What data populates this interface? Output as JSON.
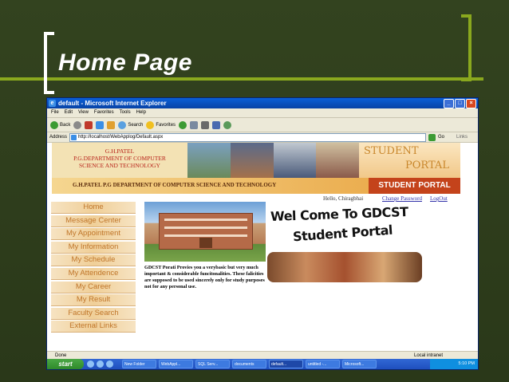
{
  "slide": {
    "title": "Home Page"
  },
  "window": {
    "title": "default - Microsoft Internet Explorer"
  },
  "menu": [
    "File",
    "Edit",
    "View",
    "Favorites",
    "Tools",
    "Help"
  ],
  "toolbar": {
    "back": "Back",
    "search": "Search",
    "favorites": "Favorites"
  },
  "address": {
    "label": "Address",
    "url": "http://localhost/WebApplog/Default.aspx",
    "go": "Go",
    "links": "Links"
  },
  "site": {
    "org_line1": "G.H.PATEL",
    "org_line2": "P.G.DEPARTMENT OF COMPUTER",
    "org_line3": "SCIENCE AND TECHNOLOGY",
    "student_word1": "STUDENT",
    "student_word2": "PORTAL",
    "bar_text": "G.H.PATEL P.G DEPARTMENT OF COMPUTER SCIENCE AND TECHNOLOGY",
    "bar_portal": "STUDENT PORTAL",
    "greeting": "Hello, Chiragbhai",
    "change_password": "Change Password",
    "logout": "LogOut"
  },
  "nav": [
    "Home",
    "Message Center",
    "My Appointment",
    "My Information",
    "My Schedule",
    "My Attendence",
    "My Career",
    "My Result",
    "Faculty Search",
    "External Links"
  ],
  "main": {
    "welcome_line1": "Wel Come To GDCST",
    "welcome_line2": "Student Portal",
    "description": "GDCST Porati Provies you a verybasic but very much important & considerable funcitonalities. These falicities are supposed to be used sincerely only for study purposes not for any personal use."
  },
  "status": {
    "left": "Done",
    "zone": "Local intranet"
  },
  "taskbar": {
    "start": "start",
    "tasks": [
      "New Folder",
      "WebAppl...",
      "SQL Serv...",
      "documents",
      "default...",
      "untitled -...",
      "Microsoft..."
    ],
    "clock": "5:10 PM"
  }
}
